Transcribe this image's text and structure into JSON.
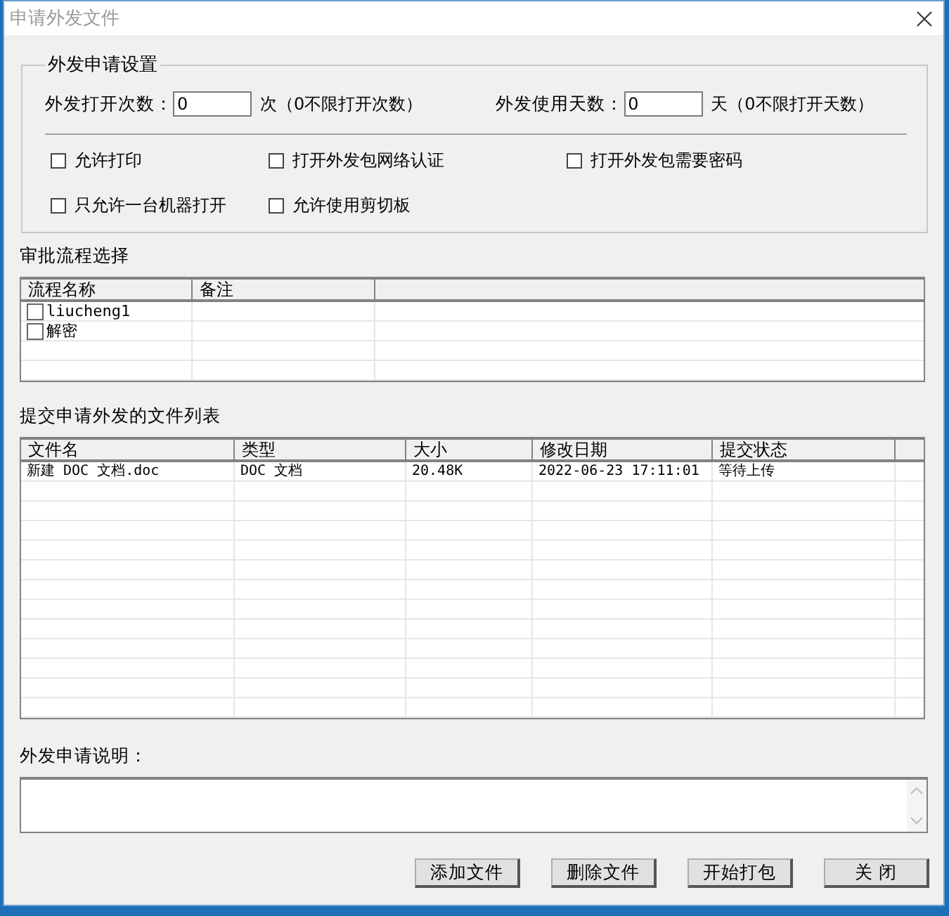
{
  "window": {
    "title": "申请外发文件"
  },
  "settings": {
    "title": "外发申请设置",
    "fields": [
      {
        "label": "外发打开次数：",
        "value": "0",
        "hint": "次（0不限打开次数）"
      },
      {
        "label": "外发使用天数：",
        "value": "0",
        "hint": "天（0不限打开天数）"
      }
    ],
    "options": [
      {
        "label": "允许打印",
        "checked": false
      },
      {
        "label": "打开外发包网络认证",
        "checked": false
      },
      {
        "label": "打开外发包需要密码",
        "checked": false
      },
      {
        "label": "只允许一台机器打开",
        "checked": false
      },
      {
        "label": "允许使用剪切板",
        "checked": false
      }
    ]
  },
  "approval": {
    "title": "审批流程选择",
    "columns": [
      "流程名称",
      "备注"
    ],
    "rows": [
      {
        "name": "liucheng1",
        "checked": false
      },
      {
        "name": "解密",
        "checked": false
      }
    ]
  },
  "files": {
    "title": "提交申请外发的文件列表",
    "columns": [
      "文件名",
      "类型",
      "大小",
      "修改日期",
      "提交状态"
    ],
    "rows": [
      [
        "新建 DOC 文档.doc",
        "DOC 文档",
        "20.48K",
        "2022-06-23 17:11:01",
        "等待上传"
      ]
    ]
  },
  "note": {
    "label": "外发申请说明："
  },
  "buttons": [
    "添加文件",
    "删除文件",
    "开始打包",
    "关 闭"
  ]
}
